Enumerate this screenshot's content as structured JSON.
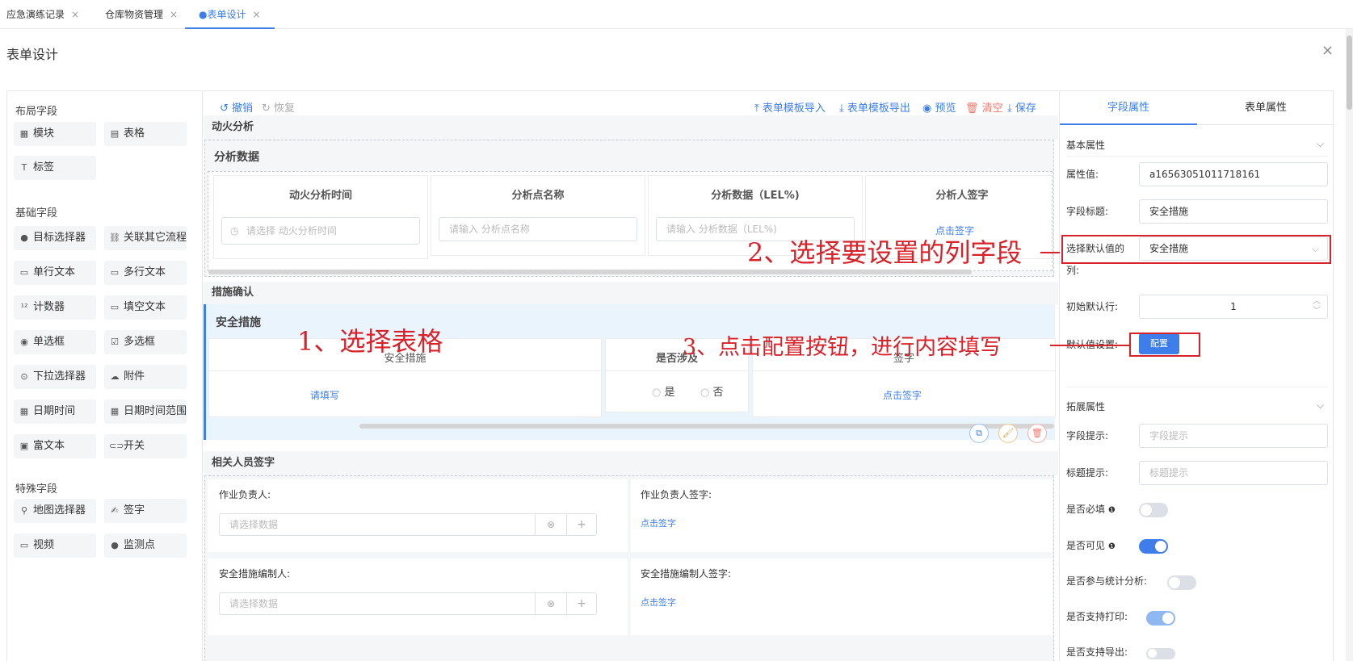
{
  "tabs": [
    {
      "label": "应急演练记录"
    },
    {
      "label": "仓库物资管理"
    },
    {
      "label": "●表单设计"
    }
  ],
  "close_glyph": "×",
  "page_title": "表单设计",
  "left_panel": {
    "group_layout": "布局字段",
    "layout_items": [
      {
        "label": "模块",
        "icon": "grid-icon"
      },
      {
        "label": "表格",
        "icon": "table-icon"
      },
      {
        "label": "标签",
        "icon": "text-icon"
      }
    ],
    "group_basic": "基础字段",
    "basic_items": [
      {
        "label": "目标选择器",
        "icon": "person-icon"
      },
      {
        "label": "关联其它流程",
        "icon": "link-icon"
      },
      {
        "label": "单行文本",
        "icon": "input-icon"
      },
      {
        "label": "多行文本",
        "icon": "textarea-icon"
      },
      {
        "label": "计数器",
        "icon": "counter-icon"
      },
      {
        "label": "填空文本",
        "icon": "blank-icon"
      },
      {
        "label": "单选框",
        "icon": "radio-icon"
      },
      {
        "label": "多选框",
        "icon": "checkbox-icon"
      },
      {
        "label": "下拉选择器",
        "icon": "dropdown-icon"
      },
      {
        "label": "附件",
        "icon": "cloud-icon"
      },
      {
        "label": "日期时间",
        "icon": "calendar-icon"
      },
      {
        "label": "日期时间范围",
        "icon": "calendar-range-icon"
      },
      {
        "label": "富文本",
        "icon": "richtext-icon"
      },
      {
        "label": "开关",
        "icon": "switch-icon"
      }
    ],
    "group_special": "特殊字段",
    "special_items": [
      {
        "label": "地图选择器",
        "icon": "map-pin-icon"
      },
      {
        "label": "签字",
        "icon": "signature-icon"
      },
      {
        "label": "视频",
        "icon": "video-icon"
      },
      {
        "label": "监测点",
        "icon": "monitor-point-icon"
      }
    ]
  },
  "toolbar": {
    "undo": "撤销",
    "redo": "恢复",
    "import": "表单模板导入",
    "export": "表单模板导出",
    "preview": "预览",
    "clear": "清空",
    "save": "保存"
  },
  "canvas": {
    "section_fire": "动火分析",
    "table1_title": "分析数据",
    "table1_headers": [
      "动火分析时间",
      "分析点名称",
      "分析数据（LEL%)",
      "分析人签字"
    ],
    "table1_placeholders": [
      "请选择 动火分析时间",
      "请输入 分析点名称",
      "请输入 分析数据（LEL%)"
    ],
    "table1_sign_link": "点击签字",
    "section_measures": "措施确认",
    "table2_title": "安全措施",
    "table2_headers": [
      "安全措施",
      "是否涉及",
      "签字"
    ],
    "table2_fill": "请填写",
    "table2_radio_yes": "是",
    "table2_radio_no": "否",
    "table2_sign": "点击签字",
    "section_sign": "相关人员签字",
    "people": [
      {
        "label": "作业负责人:",
        "placeholder": "请选择数据",
        "sign_label": "作业负责人签字:",
        "sign_link": "点击签字"
      },
      {
        "label": "安全措施编制人:",
        "placeholder": "请选择数据",
        "sign_label": "安全措施编制人签字:",
        "sign_link": "点击签字"
      }
    ]
  },
  "right_panel": {
    "tab_field": "字段属性",
    "tab_form": "表单属性",
    "basic_title": "基本属性",
    "attr_label": "属性值:",
    "attr_value": "a16563051011718161",
    "field_title_label": "字段标题:",
    "field_title_value": "安全措施",
    "default_col_label_1": "选择默认值的",
    "default_col_label_2": "列:",
    "default_col_value": "安全措施",
    "default_row_label": "初始默认行:",
    "default_row_value": "1",
    "default_setting_label": "默认值设置:",
    "config_button": "配置",
    "ext_title": "拓展属性",
    "hint_label": "字段提示:",
    "hint_placeholder": "字段提示",
    "title_hint_label": "标题提示:",
    "title_hint_placeholder": "标题提示",
    "required_label": "是否必填",
    "visible_label": "是否可见",
    "stats_label": "是否参与统计分析:",
    "print_label": "是否支持打印:",
    "export_label": "是否支持导出:",
    "switches": {
      "required": false,
      "visible": true,
      "stats": false,
      "print": true,
      "export": false
    }
  },
  "annotations": {
    "step1": "1、选择表格",
    "step2": "2、选择要设置的列字段",
    "step3": "3、点击配置按钮，进行内容填写"
  },
  "colors": {
    "accent": "#3d7eea",
    "annotation": "#d8222a",
    "danger": "#f5766c"
  }
}
